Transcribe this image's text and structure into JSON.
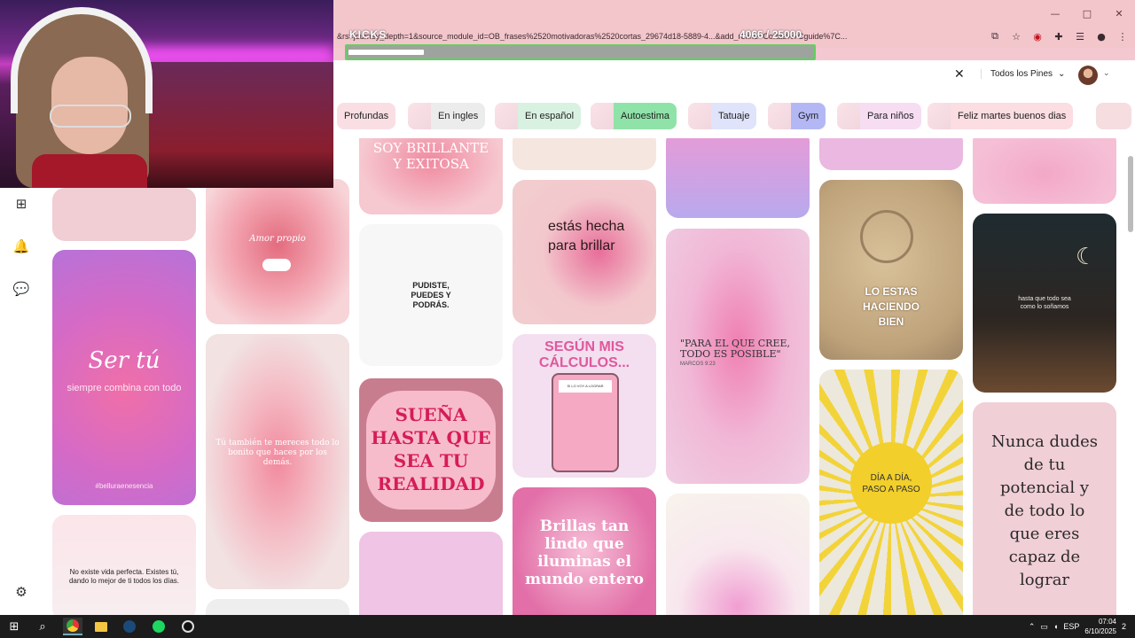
{
  "browser": {
    "url": "&rs=journey_depth=1&source_module_id=OB_frases%2520motivadoras%2520cortas_29674d18-5889-4...&add_refine=Cortas%7Cguide%7C...",
    "window_controls": [
      "—",
      "□",
      "✕"
    ],
    "address_icons": [
      "⧉",
      "☆",
      "◉",
      "✚",
      "☰",
      "●",
      "⋮"
    ]
  },
  "kicks": {
    "label": "KICKS",
    "count": "4066 / 25000",
    "progress": 0.163
  },
  "header": {
    "close_icon": "✕",
    "scope": "Todos los Pines",
    "scope_chevron": "⌄",
    "user_chevron": "⌄"
  },
  "chips": [
    {
      "label": "Profundas",
      "bg": "#f9dfe4"
    },
    {
      "label": "En ingles",
      "bg": "#ececec"
    },
    {
      "label": "En español",
      "bg": "#d9f1e1"
    },
    {
      "label": "Autoestima",
      "bg": "#8fe3a8"
    },
    {
      "label": "Tatuaje",
      "bg": "#dfe4fb"
    },
    {
      "label": "Gym",
      "bg": "#b3b8f5"
    },
    {
      "label": "Para niños",
      "bg": "#f6ddf2"
    },
    {
      "label": "Feliz martes buenos dias",
      "bg": "#fbdde2"
    }
  ],
  "pins": {
    "c1_p2_title": "Ser tú",
    "c1_p2_sub": "siempre combina con todo",
    "c1_p2_tag": "#belluraenesencia",
    "c1_p3_text": "No existe vida perfecta. Existes tú, dando lo mejor de ti todos los días.",
    "c2_p1_text": "Amor propio",
    "c2_p2_text": "Tú también te mereces todo lo bonito que haces por los demás.",
    "c3_p1_text": "SOY BRILLANTE Y EXITOSA",
    "c3_p2_text": "PUDISTE, PUEDES Y PODRÁS.",
    "c3_p3_text": "SUEÑA HASTA QUE SEA TU REALIDAD",
    "c4_p2_text": "estás hecha para brillar",
    "c4_p3_text": "SEGÚN MIS CÁLCULOS...",
    "c4_p3_calc": "SI LO VOY A LOGRAR",
    "c4_p4_text": "Brillas tan lindo que iluminas el mundo entero",
    "c5_p2_quote": "\"PARA EL QUE CREE, TODO ES POSIBLE\"",
    "c5_p2_ref": "MARCOS 9:23",
    "c6_p2_text": "LO ESTAS HACIENDO BIEN",
    "c6_p3_text": "DÍA A DÍA, PASO A PASO",
    "c7_p2_text": "hasta que todo sea como lo soñamos",
    "c7_p3_text": "Nunca dudes de tu potencial y de todo lo que eres capaz de lograr"
  },
  "taskbar": {
    "lang": "ESP",
    "time": "07:04",
    "date": "6/10/2025",
    "notif": "2"
  },
  "colors": {
    "chrome": "#f3c6cc",
    "kicks_border": "#5fd35c"
  }
}
